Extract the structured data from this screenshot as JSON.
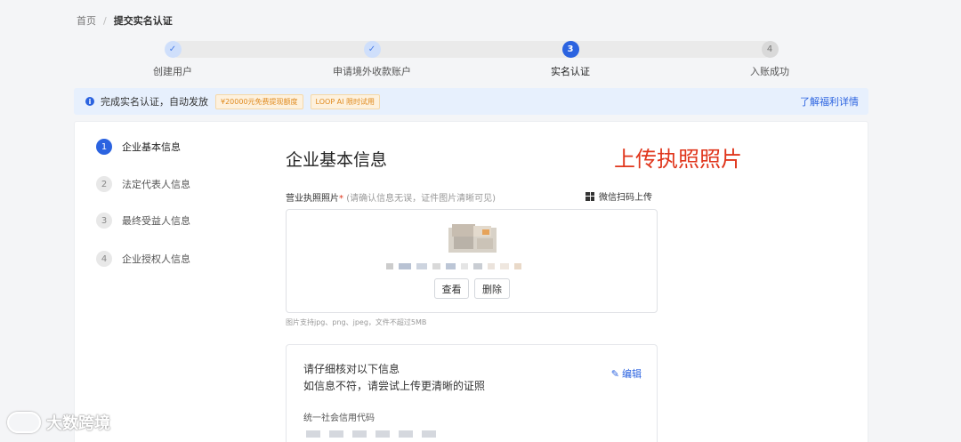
{
  "breadcrumb": {
    "home": "首页",
    "separator": "/",
    "current": "提交实名认证"
  },
  "steps": [
    {
      "label": "创建用户",
      "status": "done",
      "marker": "✓"
    },
    {
      "label": "申请境外收款账户",
      "status": "done",
      "marker": "✓"
    },
    {
      "label": "实名认证",
      "status": "active",
      "marker": "3"
    },
    {
      "label": "入账成功",
      "status": "todo",
      "marker": "4"
    }
  ],
  "banner": {
    "text": "完成实名认证，自动发放",
    "tag1": "¥20000元免费提现额度",
    "tag2": "LOOP AI 限时试用",
    "link": "了解福利详情"
  },
  "sidebar": {
    "items": [
      {
        "num": "1",
        "label": "企业基本信息",
        "active": true
      },
      {
        "num": "2",
        "label": "法定代表人信息",
        "active": false
      },
      {
        "num": "3",
        "label": "最终受益人信息",
        "active": false
      },
      {
        "num": "4",
        "label": "企业授权人信息",
        "active": false
      }
    ]
  },
  "main": {
    "title": "企业基本信息",
    "annotation": "上传执照照片",
    "field_label": "营业执照照片",
    "required_mark": "*",
    "field_hint": "(请确认信息无误，证件图片清晰可见)",
    "wechat_upload": "微信扫码上传",
    "view_button": "查看",
    "delete_button": "删除",
    "upload_tip": "图片支持jpg、png、jpeg，文件不超过5MB",
    "verify_line1": "请仔细核对以下信息",
    "verify_line2": "如信息不符，请尝试上传更清晰的证照",
    "edit_link": "编辑",
    "credit_code_label": "统一社会信用代码"
  },
  "watermark": {
    "text": "大数跨境"
  },
  "colors": {
    "primary": "#2b63e0",
    "annotation": "#e0361c",
    "banner_bg": "#e7f0fd"
  }
}
